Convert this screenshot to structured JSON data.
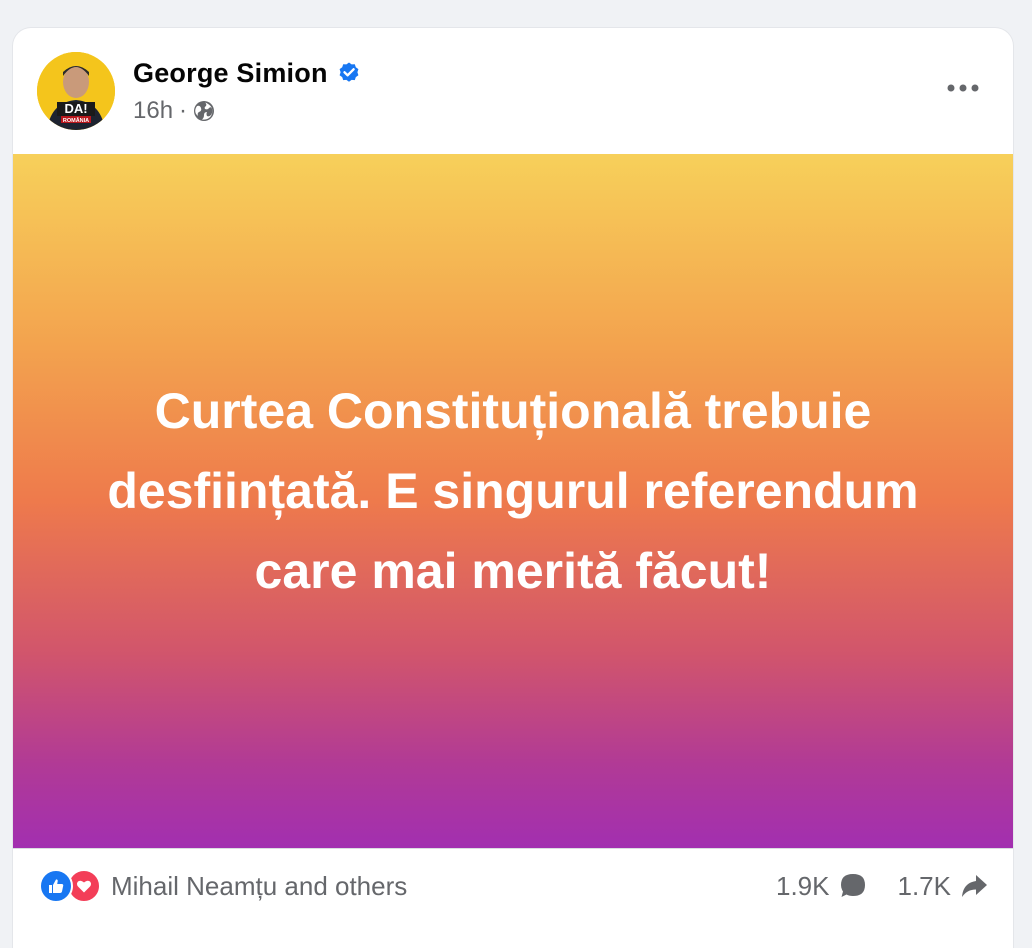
{
  "post": {
    "author": {
      "name": "George Simion",
      "avatar_label": "DA!",
      "avatar_sublabel": "ROMÂNIA",
      "verified": true
    },
    "time": "16h",
    "separator": "·",
    "audience_icon": "globe-icon",
    "more_icon": "more-options-icon",
    "text": "Curtea Constituțională trebuie desființată. E singurul referendum care mai merită făcut!",
    "background_colors": [
      "#f7d05a",
      "#ee7a4c",
      "#a22fb0"
    ]
  },
  "footer": {
    "reactions": [
      "like-icon",
      "love-icon"
    ],
    "reaction_text": "Mihail Neamțu and others",
    "comments_count": "1.9K",
    "shares_count": "1.7K"
  },
  "colors": {
    "verified_blue": "#1877f2",
    "like_blue": "#1877f2",
    "love_red": "#f33e58",
    "meta_gray": "#65676b"
  }
}
